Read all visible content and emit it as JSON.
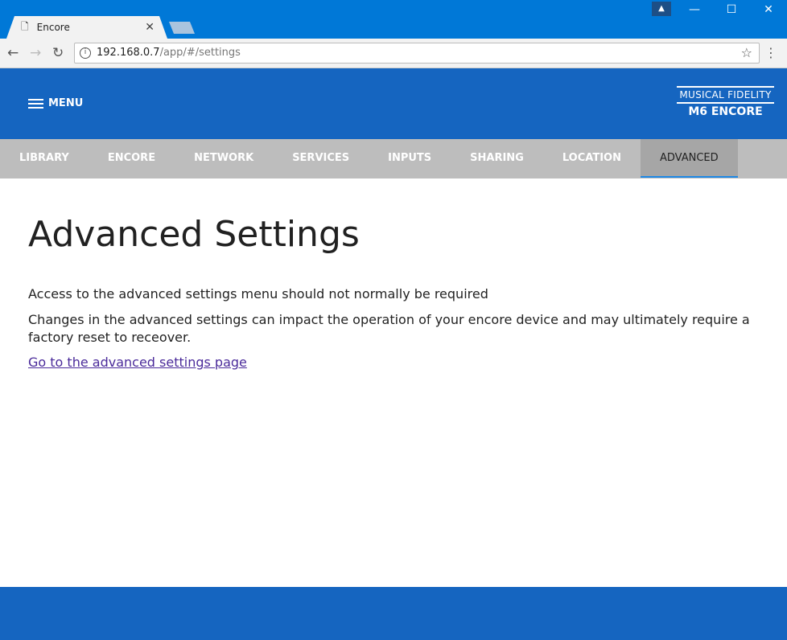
{
  "browser": {
    "tab_title": "Encore",
    "url_host": "192.168.0.7",
    "url_path": "/app/#/settings"
  },
  "header": {
    "menu_label": "MENU",
    "logo_line1": "MUSICAL FIDELITY",
    "logo_line2": "M6 ENCORE"
  },
  "tabs": [
    {
      "label": "LIBRARY"
    },
    {
      "label": "ENCORE"
    },
    {
      "label": "NETWORK"
    },
    {
      "label": "SERVICES"
    },
    {
      "label": "INPUTS"
    },
    {
      "label": "SHARING"
    },
    {
      "label": "LOCATION"
    },
    {
      "label": "ADVANCED"
    }
  ],
  "main": {
    "title": "Advanced Settings",
    "p1": "Access to the advanced settings menu should not normally be required",
    "p2": "Changes in the advanced settings can impact the operation of your encore device and may ultimately require a factory reset to receover.",
    "link": "Go to the advanced settings page"
  }
}
